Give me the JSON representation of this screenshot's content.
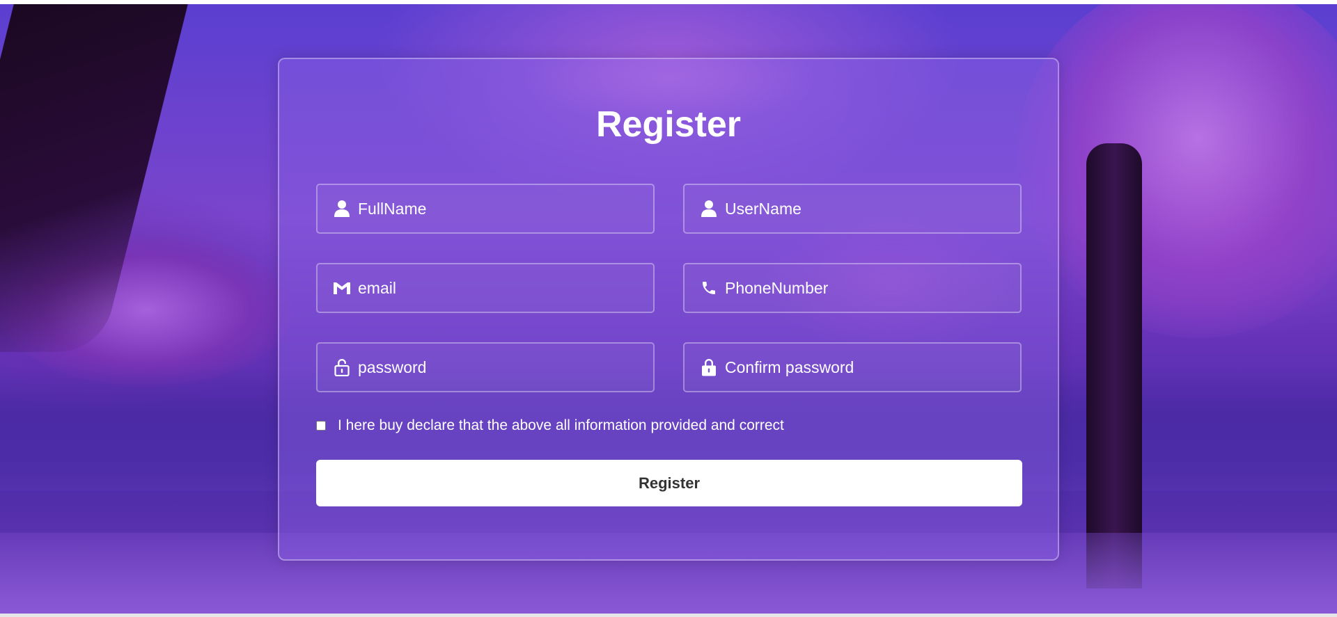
{
  "form": {
    "title": "Register",
    "fields": {
      "fullname": {
        "placeholder": "FullName",
        "icon": "user-icon",
        "value": ""
      },
      "username": {
        "placeholder": "UserName",
        "icon": "user-icon",
        "value": ""
      },
      "email": {
        "placeholder": "email",
        "icon": "gmail-icon",
        "value": ""
      },
      "phone": {
        "placeholder": "PhoneNumber",
        "icon": "phone-icon",
        "value": ""
      },
      "password": {
        "placeholder": "password",
        "icon": "lock-open-icon",
        "value": ""
      },
      "confirm_password": {
        "placeholder": "Confirm password",
        "icon": "lock-icon",
        "value": ""
      }
    },
    "declaration": {
      "label": "I here buy declare that the above all information provided and correct",
      "checked": false
    },
    "submit_label": "Register"
  },
  "colors": {
    "text": "#ffffff",
    "button_background": "#ffffff",
    "button_text": "#333333",
    "background_accent": "#7a45cc"
  }
}
